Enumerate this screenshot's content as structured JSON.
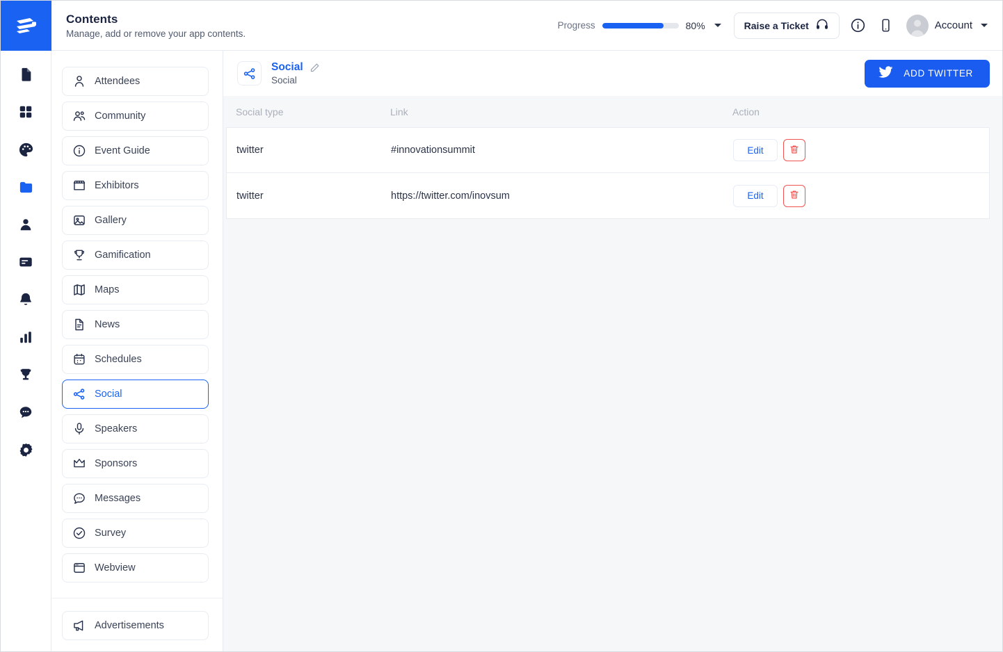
{
  "brand": {
    "logo_name": "app-logo",
    "accent": "#1a62f2"
  },
  "header": {
    "title": "Contents",
    "subtitle": "Manage, add or remove your app contents.",
    "progress_label": "Progress",
    "progress_value": "80%",
    "progress_percent": 80,
    "ticket_button": "Raise a Ticket",
    "account_label": "Account",
    "icons": [
      "headphones-icon",
      "info-icon",
      "mobile-icon",
      "avatar",
      "chevron-down-icon"
    ]
  },
  "rail": {
    "items": [
      {
        "icon": "document-icon",
        "active": false
      },
      {
        "icon": "grid-icon",
        "active": false
      },
      {
        "icon": "palette-icon",
        "active": false
      },
      {
        "icon": "folder-icon",
        "active": true
      },
      {
        "icon": "person-icon",
        "active": false
      },
      {
        "icon": "card-icon",
        "active": false
      },
      {
        "icon": "bell-icon",
        "active": false
      },
      {
        "icon": "bar-chart-icon",
        "active": false
      },
      {
        "icon": "trophy-icon",
        "active": false
      },
      {
        "icon": "chat-icon",
        "active": false
      },
      {
        "icon": "gear-icon",
        "active": false
      }
    ]
  },
  "sidebar": {
    "items": [
      {
        "label": "Attendees",
        "icon": "person-icon",
        "active": false
      },
      {
        "label": "Community",
        "icon": "people-icon",
        "active": false
      },
      {
        "label": "Event Guide",
        "icon": "info-icon",
        "active": false
      },
      {
        "label": "Exhibitors",
        "icon": "storefront-icon",
        "active": false
      },
      {
        "label": "Gallery",
        "icon": "image-icon",
        "active": false
      },
      {
        "label": "Gamification",
        "icon": "trophy-icon",
        "active": false
      },
      {
        "label": "Maps",
        "icon": "map-icon",
        "active": false
      },
      {
        "label": "News",
        "icon": "news-icon",
        "active": false
      },
      {
        "label": "Schedules",
        "icon": "calendar-icon",
        "active": false
      },
      {
        "label": "Social",
        "icon": "share-icon",
        "active": true
      },
      {
        "label": "Speakers",
        "icon": "microphone-icon",
        "active": false
      },
      {
        "label": "Sponsors",
        "icon": "crown-icon",
        "active": false
      },
      {
        "label": "Messages",
        "icon": "chat-icon",
        "active": false
      },
      {
        "label": "Survey",
        "icon": "check-circle-icon",
        "active": false
      },
      {
        "label": "Webview",
        "icon": "browser-icon",
        "active": false
      }
    ],
    "footer_items": [
      {
        "label": "Advertisements",
        "icon": "megaphone-icon",
        "active": false
      }
    ]
  },
  "main": {
    "entity_title": "Social",
    "entity_subtitle": "Social",
    "entity_icon": "share-icon",
    "edit_title_icon": "pencil-icon",
    "add_button": "ADD TWITTER",
    "add_button_icon": "twitter-icon",
    "table": {
      "columns": [
        "Social type",
        "Link",
        "Action"
      ],
      "rows": [
        {
          "type": "twitter",
          "link": "#innovationsummit",
          "edit": "Edit",
          "delete_icon": "trash-icon"
        },
        {
          "type": "twitter",
          "link": "https://twitter.com/inovsum",
          "edit": "Edit",
          "delete_icon": "trash-icon"
        }
      ]
    }
  }
}
